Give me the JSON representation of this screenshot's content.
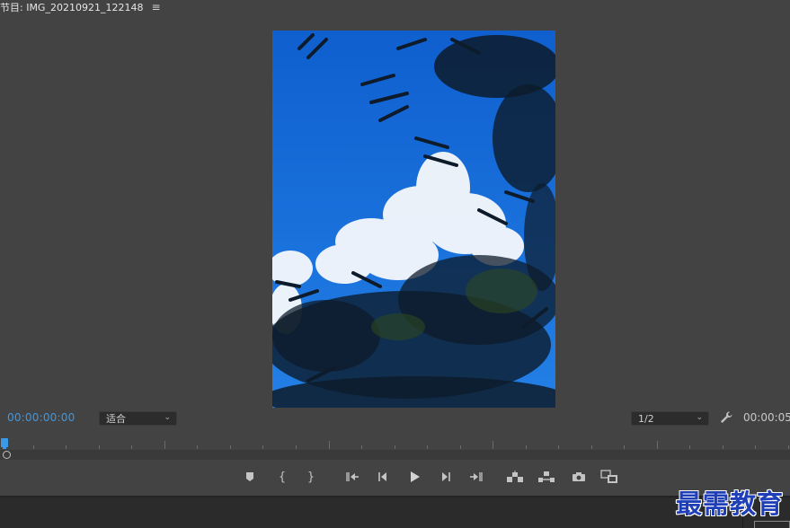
{
  "panel": {
    "title": "节目: IMG_20210921_122148",
    "menu_glyph": "≡"
  },
  "monitor": {
    "content": "photo of blue sky with white cloud framed by bamboo leaves",
    "colors": {
      "sky": "#1a6fd8",
      "cloud": "#f2f6fb",
      "leaves": "#0d1b2a"
    }
  },
  "controls": {
    "timecode_current": "00:00:00:00",
    "timecode_duration": "00:00:05",
    "zoom": {
      "selected": "适合"
    },
    "resolution": {
      "selected": "1/2"
    },
    "settings_icon": "wrench-icon"
  },
  "transport": {
    "buttons": [
      {
        "name": "add-marker-button",
        "icon": "marker-icon"
      },
      {
        "name": "mark-in-button",
        "icon": "bracket-open-icon",
        "glyph": "{"
      },
      {
        "name": "mark-out-button",
        "icon": "bracket-close-icon",
        "glyph": "}"
      },
      {
        "name": "go-to-in-button",
        "icon": "go-to-in-icon"
      },
      {
        "name": "step-back-button",
        "icon": "step-back-icon"
      },
      {
        "name": "play-button",
        "icon": "play-icon"
      },
      {
        "name": "step-forward-button",
        "icon": "step-forward-icon"
      },
      {
        "name": "go-to-out-button",
        "icon": "go-to-out-icon"
      },
      {
        "name": "lift-button",
        "icon": "lift-icon"
      },
      {
        "name": "extract-button",
        "icon": "extract-icon"
      },
      {
        "name": "export-frame-button",
        "icon": "camera-icon"
      },
      {
        "name": "comparison-view-button",
        "icon": "comparison-icon"
      }
    ]
  },
  "accent_color": "#3a9ae8",
  "watermark": {
    "text": "最需教育",
    "color": "#1f3fb8"
  }
}
